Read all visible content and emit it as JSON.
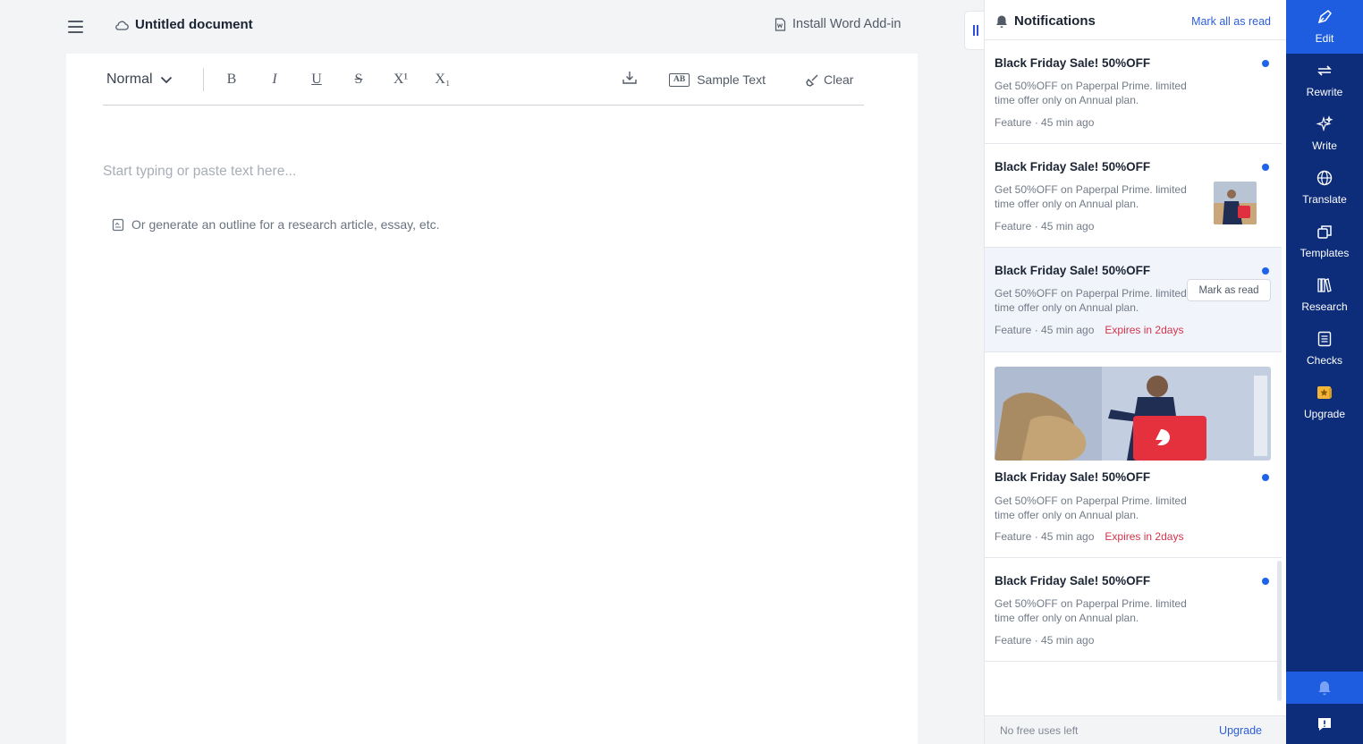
{
  "header": {
    "doc_title": "Untitled document",
    "install_addin": "Install Word Add-in"
  },
  "toolbar": {
    "style_select": "Normal",
    "bold": "B",
    "italic": "I",
    "underline": "U",
    "strike": "S",
    "superscript": "X¹",
    "subscript": "X₁",
    "sample_badge": "AB",
    "sample_text": "Sample Text",
    "clear": "Clear"
  },
  "editor": {
    "placeholder": "Start typing or paste text here...",
    "outline_link": "Or generate an outline for a research article, essay, etc."
  },
  "notifications": {
    "title": "Notifications",
    "mark_all": "Mark all as read",
    "mark_tooltip": "Mark as read",
    "items": [
      {
        "title": "Black Friday Sale! 50%OFF",
        "body": "Get 50%OFF on Paperpal Prime. limited time offer only on Annual plan.",
        "category": "Feature",
        "time": "· 45 min ago",
        "expires": ""
      },
      {
        "title": "Black Friday Sale! 50%OFF",
        "body": "Get 50%OFF on Paperpal Prime. limited time offer only on Annual plan.",
        "category": "Feature",
        "time": "· 45 min ago",
        "expires": ""
      },
      {
        "title": "Black Friday Sale! 50%OFF",
        "body": "Get 50%OFF on Paperpal Prime. limited time offer only on Annual plan.",
        "category": "Feature",
        "time": "· 45 min ago",
        "expires": "Expires in 2days"
      },
      {
        "title": "Black Friday Sale! 50%OFF",
        "body": "Get 50%OFF on Paperpal Prime. limited time offer only on Annual plan.",
        "category": "Feature",
        "time": "· 45 min ago",
        "expires": "Expires in 2days"
      },
      {
        "title": "Black Friday Sale! 50%OFF",
        "body": "Get 50%OFF on Paperpal Prime. limited time offer only on Annual plan.",
        "category": "Feature",
        "time": "· 45 min ago",
        "expires": ""
      }
    ],
    "footer_text": "No free uses left",
    "footer_upgrade": "Upgrade"
  },
  "nav": {
    "items": [
      {
        "label": "Edit",
        "icon": "pen-nib-icon"
      },
      {
        "label": "Rewrite",
        "icon": "rewrite-arrows-icon"
      },
      {
        "label": "Write",
        "icon": "sparkle-icon"
      },
      {
        "label": "Translate",
        "icon": "globe-icon"
      },
      {
        "label": "Templates",
        "icon": "templates-icon"
      },
      {
        "label": "Research",
        "icon": "books-icon"
      },
      {
        "label": "Checks",
        "icon": "checklist-icon"
      },
      {
        "label": "Upgrade",
        "icon": "star-badge-icon"
      }
    ]
  },
  "colors": {
    "nav_bg": "#0d2d7a",
    "nav_active": "#1e5ce0",
    "unread_dot": "#1e63e9",
    "link_blue": "#2d5ed9",
    "expires_red": "#d4344b"
  }
}
